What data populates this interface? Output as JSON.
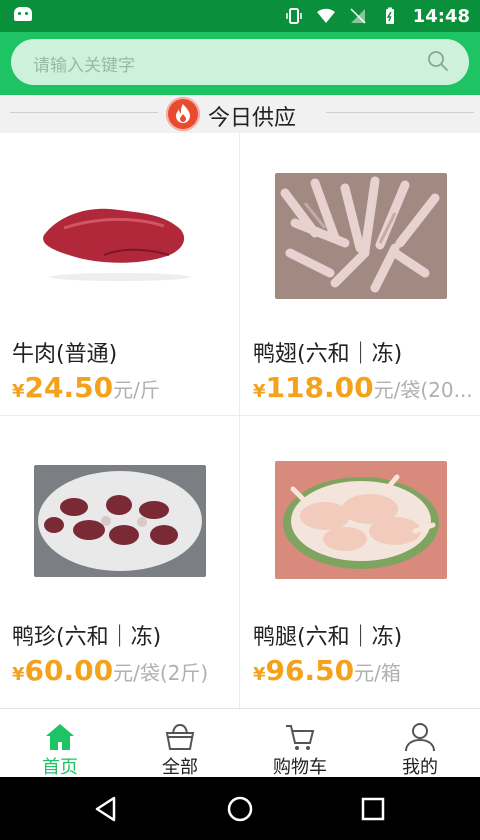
{
  "status_bar": {
    "time": "14:48"
  },
  "search": {
    "placeholder": "请输入关键字"
  },
  "section": {
    "title": "今日供应"
  },
  "products": [
    {
      "name": "牛肉(普通)",
      "currency": "¥",
      "price": "24.50",
      "unit": "元/斤",
      "image": "beef-image"
    },
    {
      "name": "鸭翅(六和｜冻)",
      "currency": "¥",
      "price": "118.00",
      "unit": "元/袋(20...",
      "image": "duck-wings-image"
    },
    {
      "name": "鸭珍(六和｜冻)",
      "currency": "¥",
      "price": "60.00",
      "unit": "元/袋(2斤)",
      "image": "duck-gizzard-image"
    },
    {
      "name": "鸭腿(六和｜冻)",
      "currency": "¥",
      "price": "96.50",
      "unit": "元/箱",
      "image": "duck-legs-image"
    }
  ],
  "tabs": [
    {
      "label": "首页",
      "icon": "home-icon",
      "active": true
    },
    {
      "label": "全部",
      "icon": "basket-icon",
      "active": false
    },
    {
      "label": "购物车",
      "icon": "cart-icon",
      "active": false
    },
    {
      "label": "我的",
      "icon": "user-icon",
      "active": false
    }
  ],
  "colors": {
    "brand": "#1ec363",
    "status_bar": "#0a8f3a",
    "price": "#f4a21c"
  }
}
